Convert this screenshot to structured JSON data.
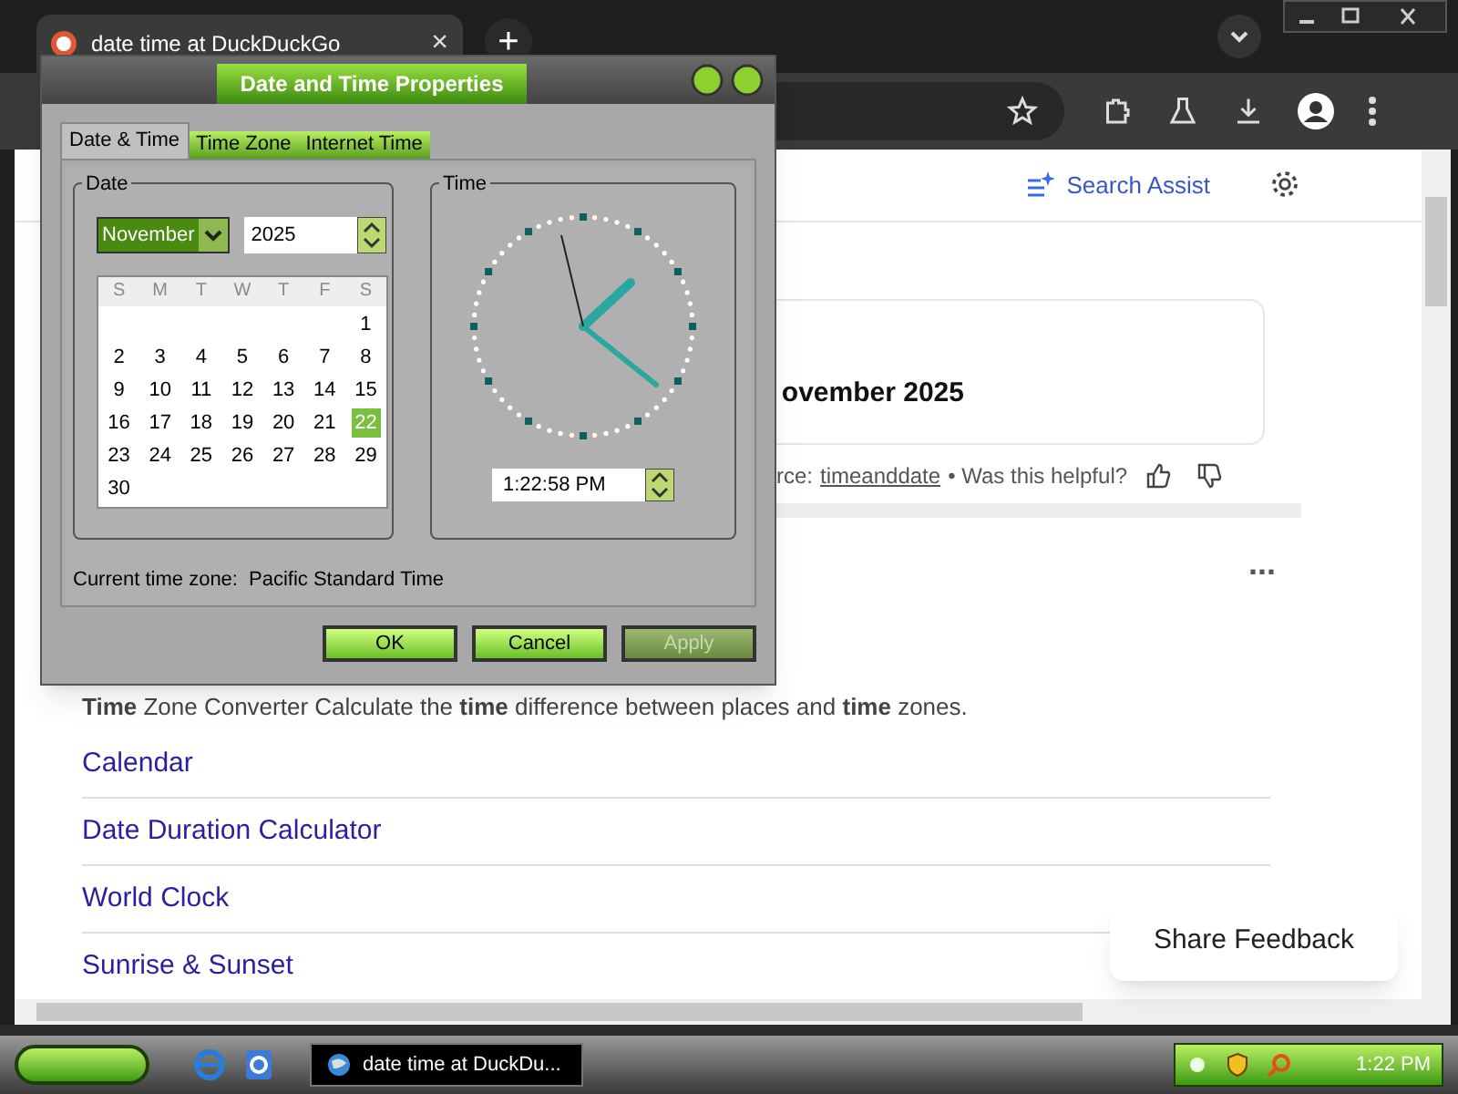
{
  "browser": {
    "tab": {
      "title": "date time at DuckDuckGo",
      "close": "×"
    },
    "new_tab": "+"
  },
  "page": {
    "search_assist": "Search Assist",
    "answer_text": "ovember 2025",
    "source_prefix": "rce: ",
    "source_link": "timeanddate",
    "helpful": "• Was this helpful?",
    "more": "...",
    "snippet": "**Time** Zone Converter Calculate the **time** difference between places and **time** zones.",
    "links": [
      "Calendar",
      "Date Duration Calculator",
      "World Clock",
      "Sunrise & Sunset"
    ],
    "feedback": "Share Feedback"
  },
  "dialog": {
    "title": "Date and Time Properties",
    "tabs": [
      {
        "label": "Date & Time",
        "selected": true
      },
      {
        "label": "Time Zone",
        "selected": false
      },
      {
        "label": "Internet Time",
        "selected": false
      }
    ],
    "date_group": "Date",
    "month": "November",
    "year": "2025",
    "weekdays": [
      "S",
      "M",
      "T",
      "W",
      "T",
      "F",
      "S"
    ],
    "days": [
      {
        "label": "1",
        "selected": false
      },
      {
        "label": "2",
        "selected": false
      },
      {
        "label": "3",
        "selected": false
      },
      {
        "label": "4",
        "selected": false
      },
      {
        "label": "5",
        "selected": false
      },
      {
        "label": "6",
        "selected": false
      },
      {
        "label": "7",
        "selected": false
      },
      {
        "label": "8",
        "selected": false
      },
      {
        "label": "9",
        "selected": false
      },
      {
        "label": "10",
        "selected": false
      },
      {
        "label": "11",
        "selected": false
      },
      {
        "label": "12",
        "selected": false
      },
      {
        "label": "13",
        "selected": false
      },
      {
        "label": "14",
        "selected": false
      },
      {
        "label": "15",
        "selected": false
      },
      {
        "label": "16",
        "selected": false
      },
      {
        "label": "17",
        "selected": false
      },
      {
        "label": "18",
        "selected": false
      },
      {
        "label": "19",
        "selected": false
      },
      {
        "label": "20",
        "selected": false
      },
      {
        "label": "21",
        "selected": false
      },
      {
        "label": "22",
        "selected": true
      },
      {
        "label": "23",
        "selected": false
      },
      {
        "label": "24",
        "selected": false
      },
      {
        "label": "25",
        "selected": false
      },
      {
        "label": "26",
        "selected": false
      },
      {
        "label": "27",
        "selected": false
      },
      {
        "label": "28",
        "selected": false
      },
      {
        "label": "29",
        "selected": false
      },
      {
        "label": "30",
        "selected": false
      }
    ],
    "time_group": "Time",
    "time": "1:22:58 PM",
    "timezone_label": "Current time zone:",
    "timezone": "Pacific Standard Time",
    "buttons": [
      {
        "label": "OK",
        "disabled": false
      },
      {
        "label": "Cancel",
        "disabled": false
      },
      {
        "label": "Apply",
        "disabled": true
      }
    ]
  },
  "taskbar": {
    "task": "date time at DuckDu...",
    "clock": "1:22 PM"
  }
}
